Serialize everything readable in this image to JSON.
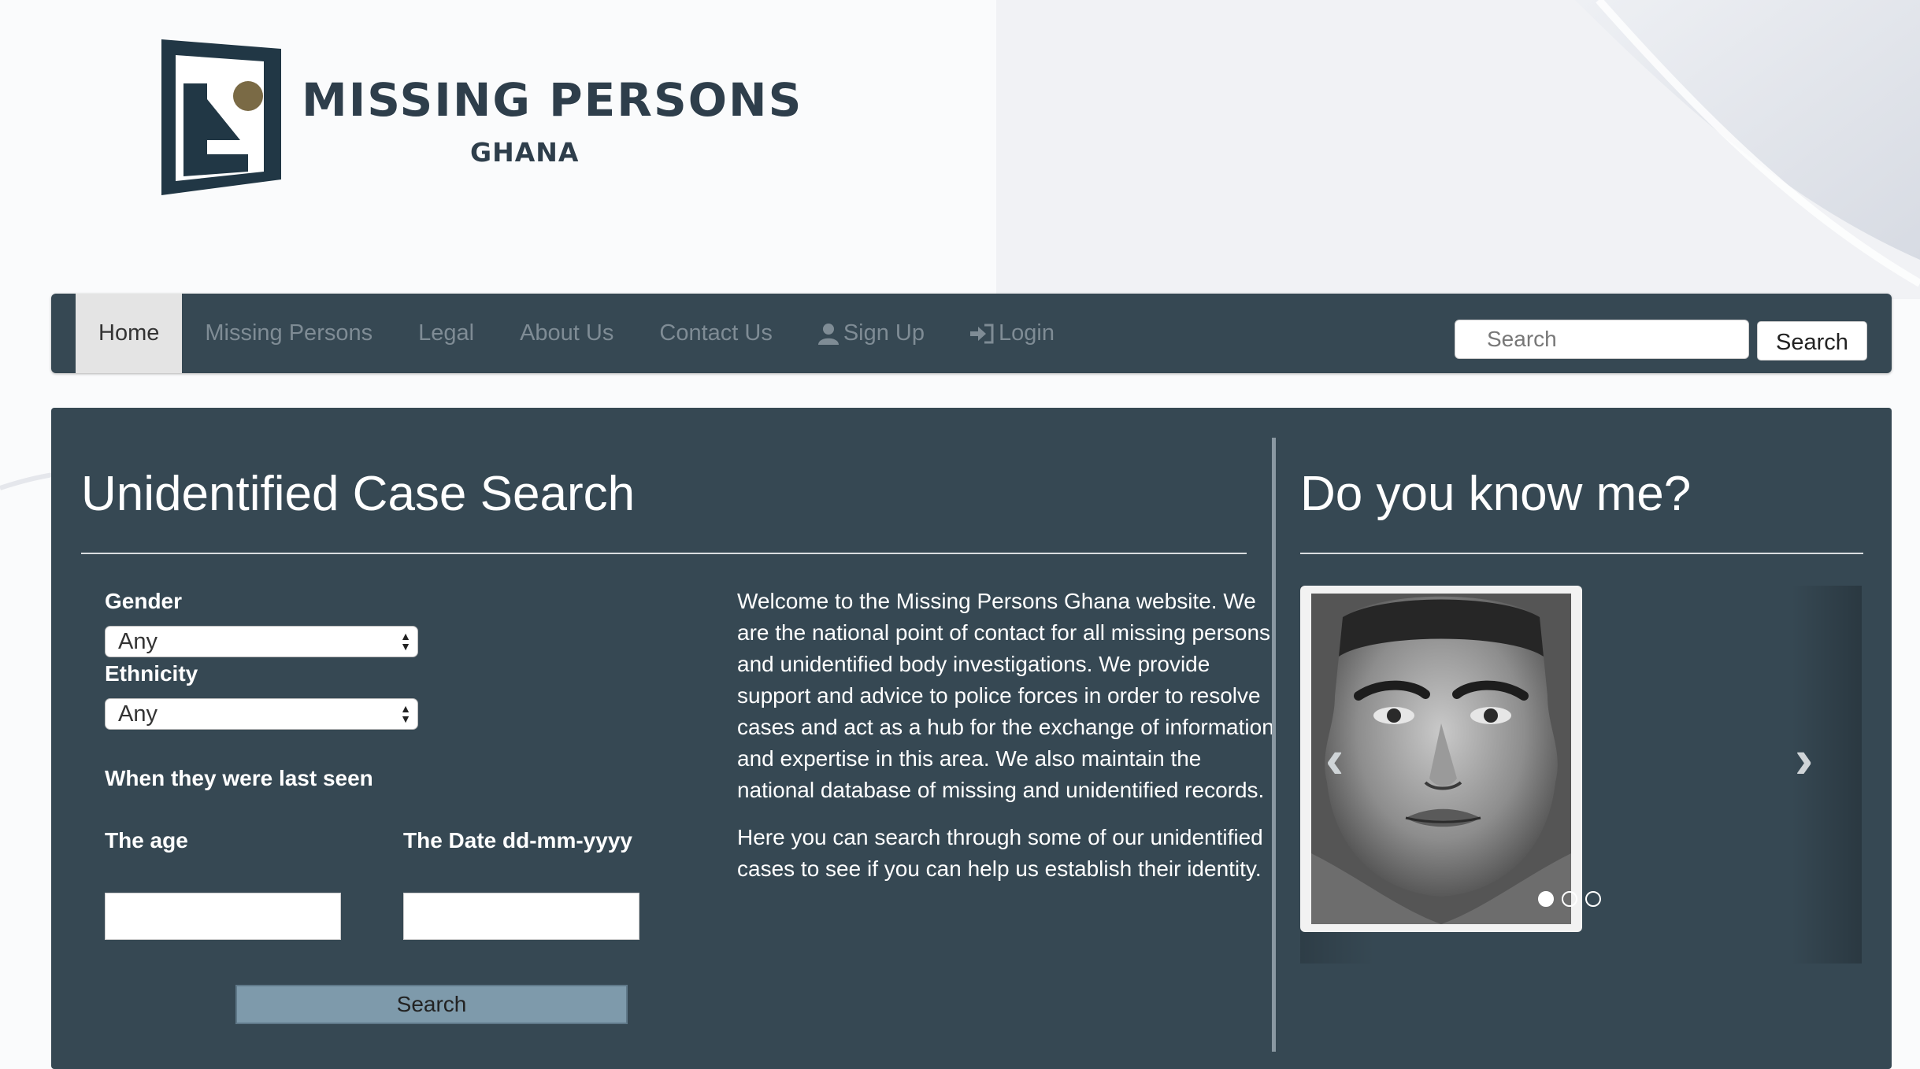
{
  "logo": {
    "title": "MISSING PERSONS",
    "subtitle": "GHANA"
  },
  "nav": {
    "items": [
      {
        "label": "Home",
        "active": true
      },
      {
        "label": "Missing Persons"
      },
      {
        "label": "Legal"
      },
      {
        "label": "About Us"
      },
      {
        "label": "Contact Us"
      },
      {
        "label": "Sign Up",
        "icon": "user-icon"
      },
      {
        "label": "Login",
        "icon": "login-icon"
      }
    ],
    "search_placeholder": "Search",
    "search_button": "Search"
  },
  "search_panel": {
    "title": "Unidentified Case Search",
    "gender_label": "Gender",
    "gender_value": "Any",
    "ethnicity_label": "Ethnicity",
    "ethnicity_value": "Any",
    "last_seen_label": "When they were last seen",
    "age_label": "The age",
    "date_label": "The Date dd-mm-yyyy",
    "search_button": "Search"
  },
  "intro": {
    "p1": "Welcome to the Missing Persons Ghana website. We are the national point of contact for all missing persons and unidentified body investigations. We provide support and advice to police forces in order to resolve cases and act as a hub for the exchange of information and expertise in this area. We also maintain the national database of missing and unidentified records.",
    "p2": "Here you can search through some of our unidentified cases to see if you can help us establish their identity."
  },
  "carousel": {
    "title": "Do you know me?",
    "slide_count": 3,
    "active_slide": 0,
    "prev_icon": "chevron-left-icon",
    "next_icon": "chevron-right-icon"
  },
  "colors": {
    "panel": "#364853",
    "nav_active": "#e4e4e4",
    "form_button": "#7e9aab"
  }
}
